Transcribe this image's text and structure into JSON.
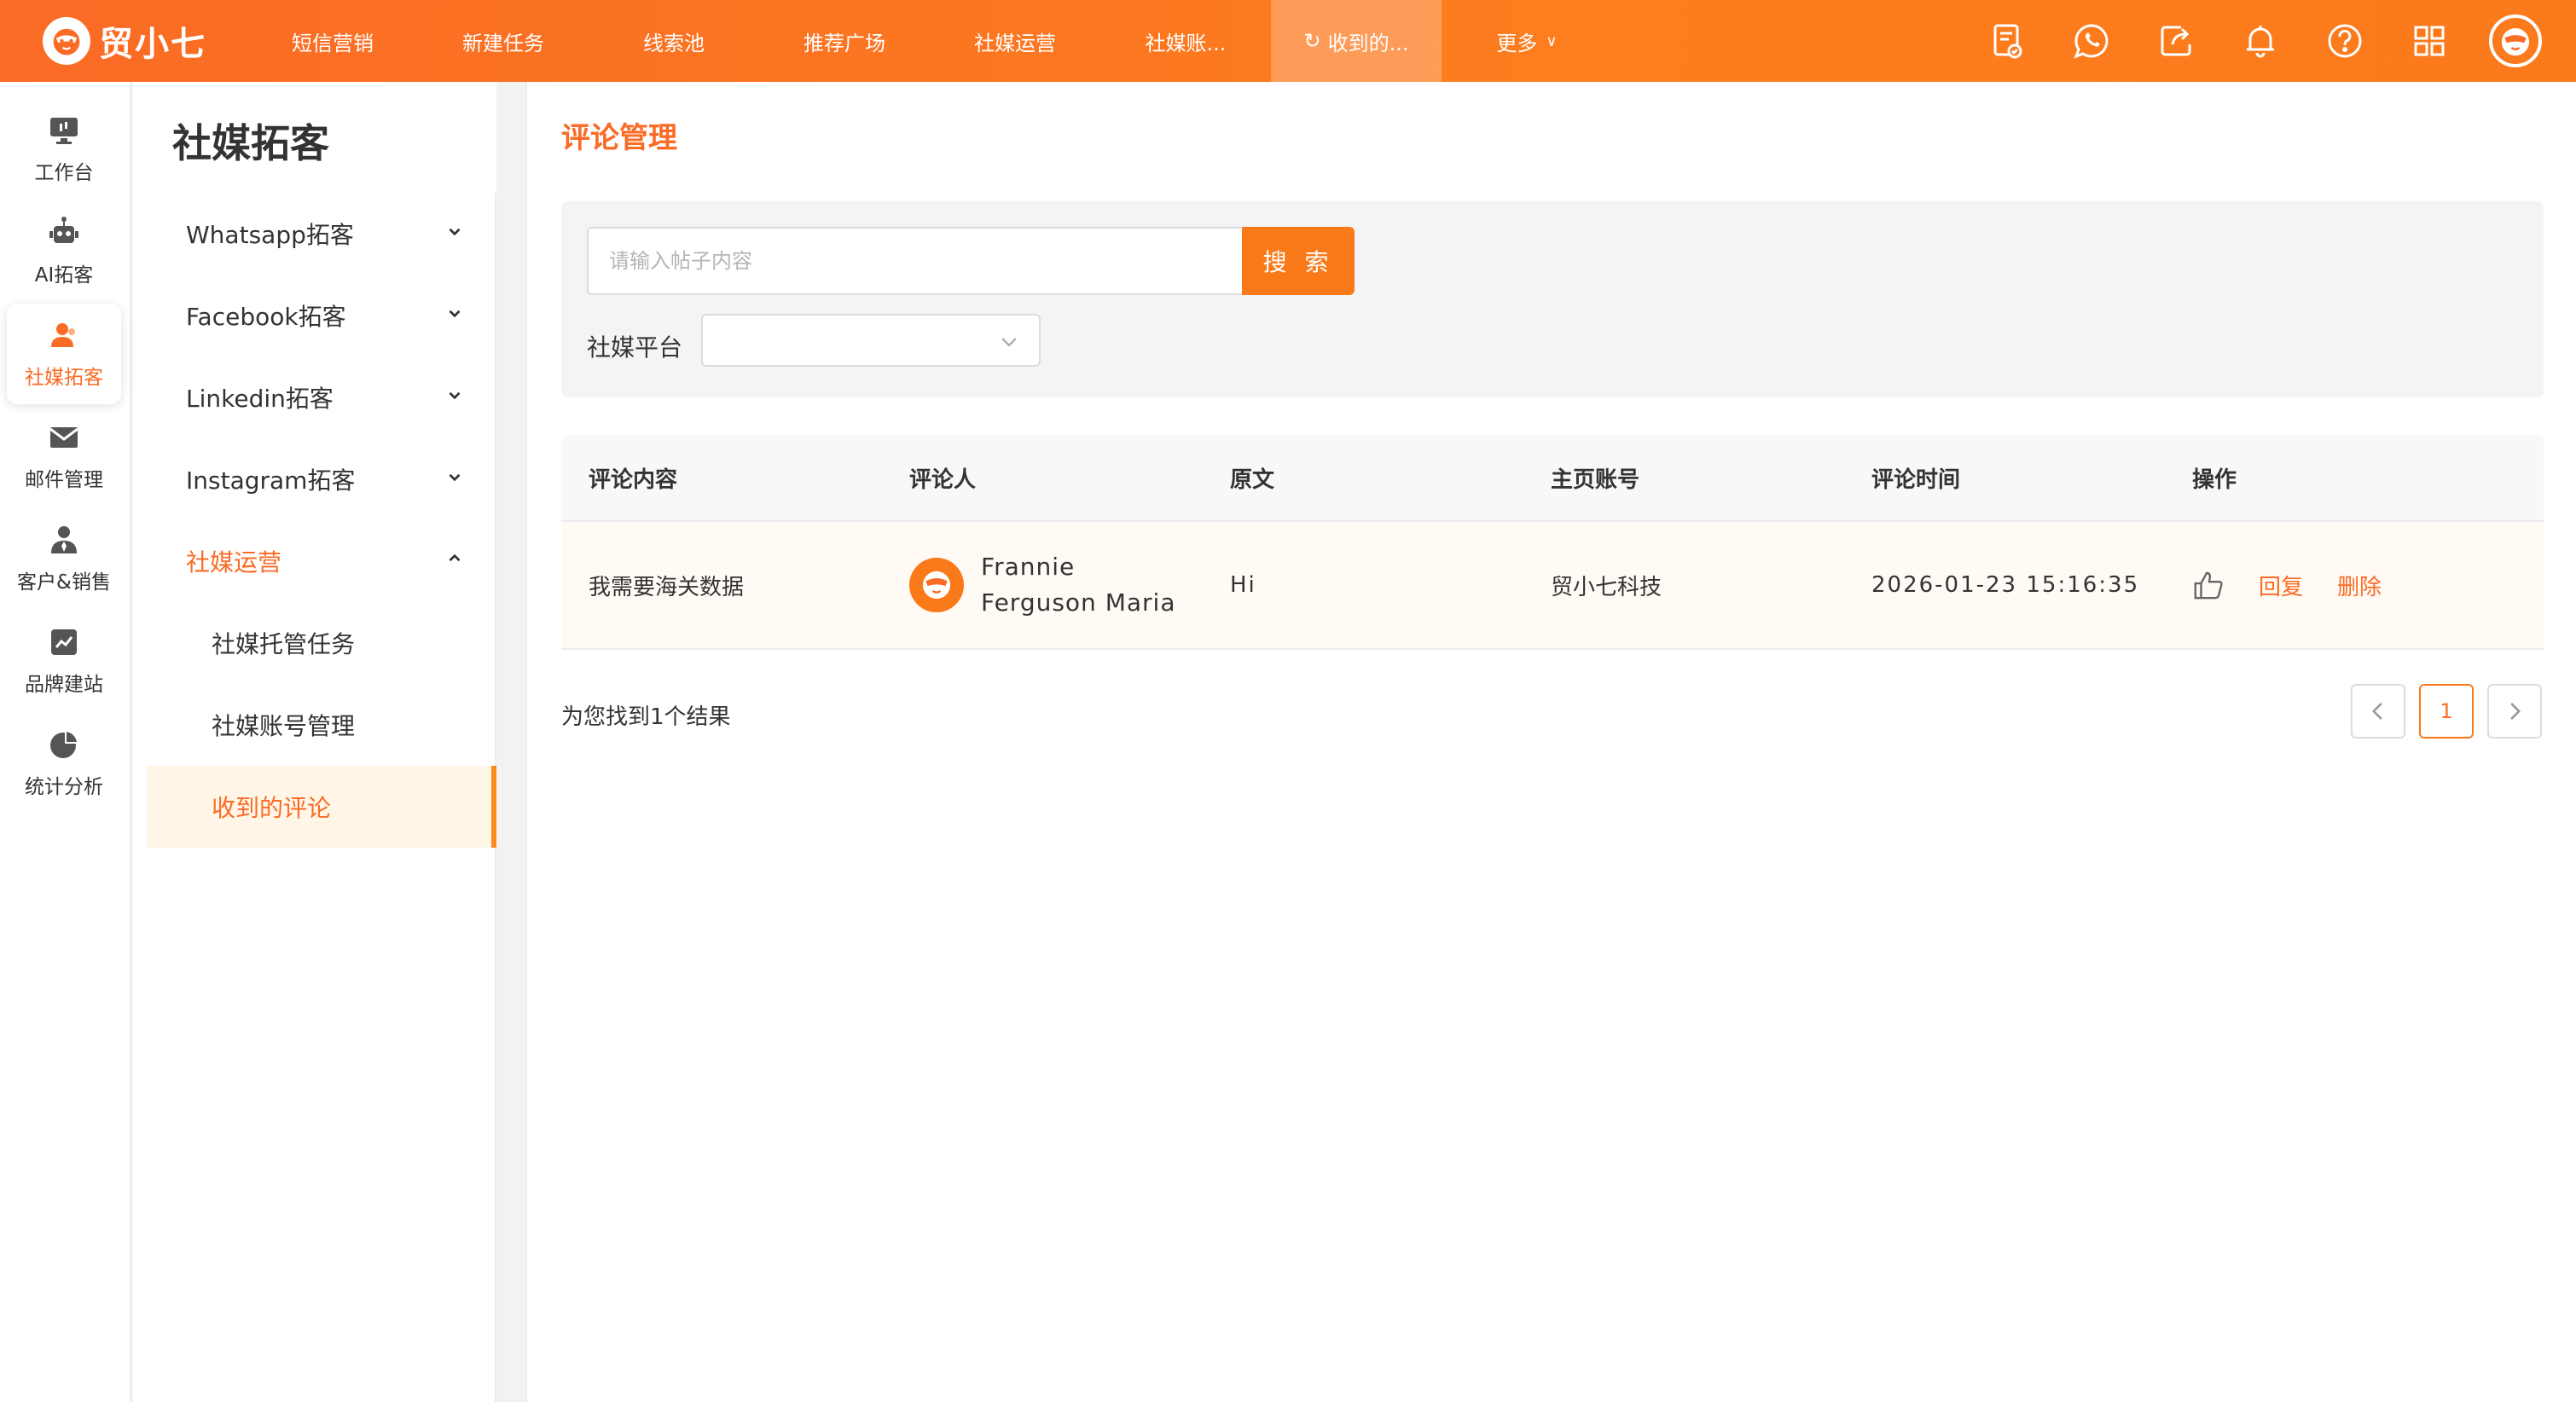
{
  "brand": {
    "name": "贸小七"
  },
  "nav": {
    "items": [
      "短信营销",
      "新建任务",
      "线索池",
      "推荐广场",
      "社媒运营",
      "社媒账...",
      "收到的...",
      "更多"
    ],
    "active_index": 6
  },
  "rail": {
    "items": [
      "工作台",
      "AI拓客",
      "社媒拓客",
      "邮件管理",
      "客户&销售",
      "品牌建站",
      "统计分析"
    ],
    "active_index": 2
  },
  "submenu": {
    "title": "社媒拓客",
    "groups": [
      "Whatsapp拓客",
      "Facebook拓客",
      "Linkedin拓客",
      "Instagram拓客",
      "社媒运营"
    ],
    "children": [
      "社媒托管任务",
      "社媒账号管理",
      "收到的评论"
    ],
    "active_child": "收到的评论"
  },
  "page": {
    "title": "评论管理"
  },
  "filters": {
    "search_placeholder": "请输入帖子内容",
    "search_button": "搜 索",
    "platform_label": "社媒平台",
    "platform_value": ""
  },
  "table": {
    "headers": [
      "评论内容",
      "评论人",
      "原文",
      "主页账号",
      "评论时间",
      "操作"
    ],
    "rows": [
      {
        "content": "我需要海关数据",
        "author_line1": "Frannie",
        "author_line2": "Ferguson Maria",
        "original": "Hi",
        "account": "贸小七科技",
        "time": "2026-01-23 15:16:35",
        "reply": "回复",
        "delete": "删除"
      }
    ]
  },
  "result": {
    "text": "为您找到1个结果"
  },
  "pagination": {
    "current": "1"
  },
  "colors": {
    "accent": "#fa6b25",
    "accent_light": "#fff6e8",
    "button": "#fa7a1a"
  }
}
